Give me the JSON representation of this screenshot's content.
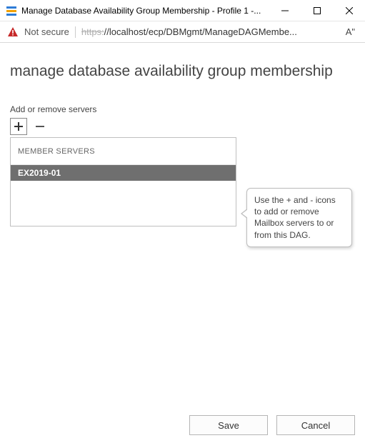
{
  "window": {
    "title": "Manage Database Availability Group Membership - Profile 1 -..."
  },
  "address": {
    "not_secure": "Not secure",
    "url_strike": "https:",
    "url_rest": "//localhost/ecp/DBMgmt/ManageDAGMembe...",
    "aa": "A\""
  },
  "page": {
    "title": "manage database availability group membership",
    "section_label": "Add or remove servers"
  },
  "grid": {
    "header": "MEMBER SERVERS",
    "rows": [
      "EX2019-01"
    ]
  },
  "callout": {
    "text": "Use the + and - icons to add or remove Mailbox servers to or from this DAG."
  },
  "footer": {
    "save": "Save",
    "cancel": "Cancel"
  }
}
